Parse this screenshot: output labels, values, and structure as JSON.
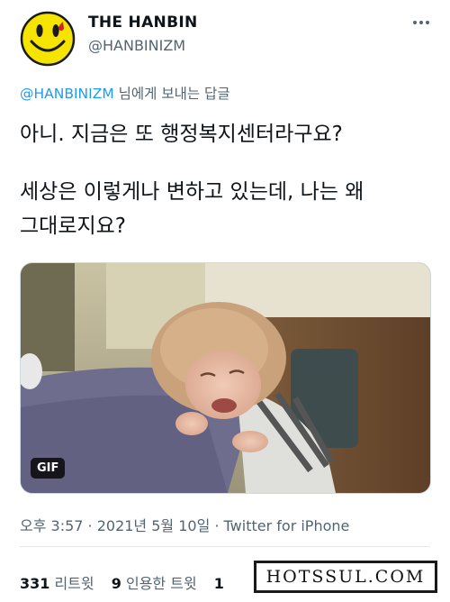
{
  "author": {
    "display_name": "THE HANBIN",
    "handle": "@HANBINIZM",
    "avatar_icon": "smiley-face-avatar-icon"
  },
  "reply_context": {
    "mention": "@HANBINIZM",
    "suffix": " 님에게 보내는 답글"
  },
  "tweet": {
    "line1": "아니. 지금은 또 행정복지센터라구요?",
    "line2": "세상은 이렇게나 변하고 있는데, 나는 왜",
    "line3": "그대로지요?"
  },
  "media": {
    "type": "GIF",
    "badge_label": "GIF",
    "description_icon": "crying-toddler-gif"
  },
  "meta": {
    "timestamp": "오후 3:57 · 2021년 5월 10일 · Twitter for iPhone"
  },
  "stats": {
    "retweets_count": "331",
    "retweets_label": " 리트윗",
    "quotes_count": "9",
    "quotes_label": " 인용한 트윗",
    "likes_count_partial": "1"
  },
  "watermark": {
    "text": "HOTSSUL.COM"
  },
  "colors": {
    "accent": "#1d9bf0",
    "secondary_text": "#536471",
    "primary_text": "#0f1419",
    "avatar_yellow": "#f5e300"
  }
}
